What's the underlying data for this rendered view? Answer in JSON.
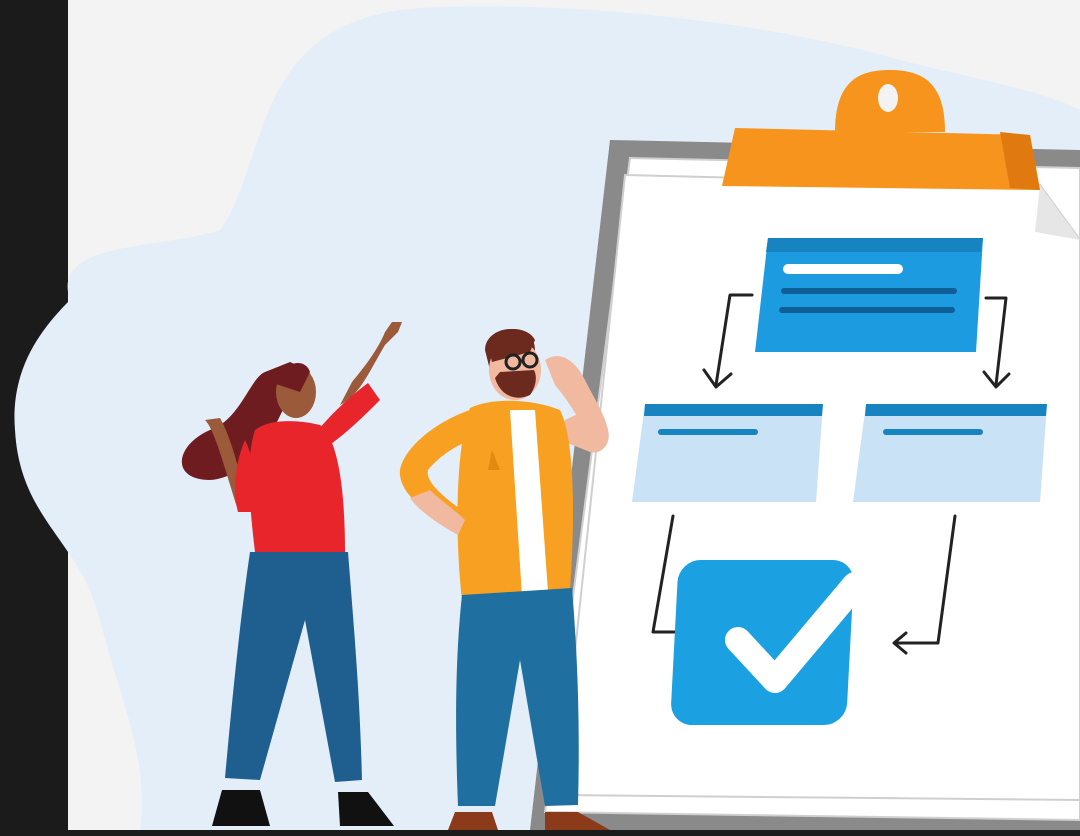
{
  "scene": {
    "subject": "clipboard-flowchart-illustration",
    "colors": {
      "frame_dark": "#1b1b1b",
      "canvas": "#f3f3f3",
      "blob": "#e3eef9",
      "clipboard_border": "#8a8a8a",
      "clip_orange": "#f7941d",
      "flow_blue": "#1c9be0",
      "flow_light": "#c9e2f6",
      "check_blue": "#1ba1e2",
      "woman_shirt": "#e8252b",
      "man_shirt": "#f7a021",
      "pants": "#1f5f8f"
    },
    "icons": [
      "clipboard-icon",
      "flowchart-icon",
      "checkmark-icon"
    ]
  }
}
